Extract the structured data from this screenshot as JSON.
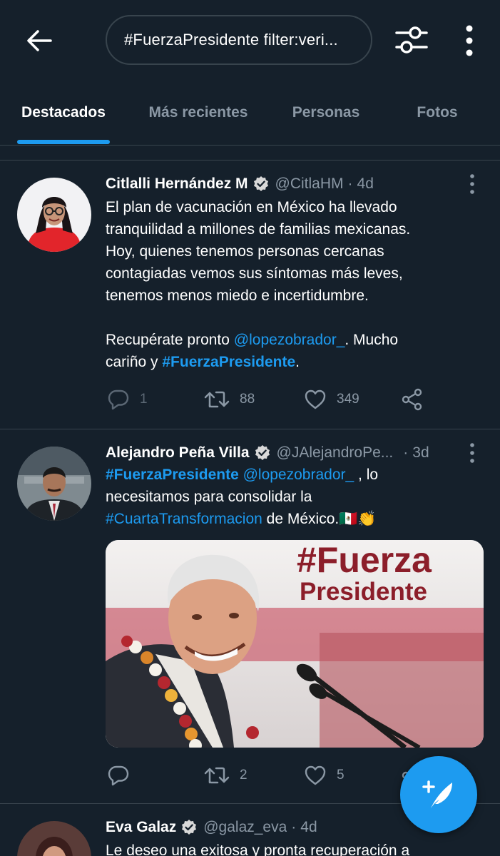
{
  "search": {
    "query": "#FuerzaPresidente  filter:veri..."
  },
  "tabs": [
    {
      "label": "Destacados",
      "active": true
    },
    {
      "label": "Más recientes",
      "active": false
    },
    {
      "label": "Personas",
      "active": false
    },
    {
      "label": "Fotos",
      "active": false
    }
  ],
  "tweets": [
    {
      "name": "Citlalli Hernández M",
      "handle": "@CitlaHM",
      "time": "4d",
      "text_lines": [
        "El plan de vacunación en México ha llevado",
        "tranquilidad a millones de familias mexicanas.",
        "Hoy, quienes tenemos personas cercanas",
        "contagiadas vemos sus síntomas más leves,",
        "tenemos menos miedo e incertidumbre."
      ],
      "p2_a": "Recupérate pronto ",
      "p2_mention": "@lopezobrador_",
      "p2_b": ". Mucho",
      "p3_a": "cariño y ",
      "p3_tag": "#FuerzaPresidente",
      "p3_b": ".",
      "replies": "1",
      "retweets": "88",
      "likes": "349"
    },
    {
      "name": "Alejandro Peña Villa",
      "handle": "@JAlejandroPe...",
      "time": "3d",
      "l1_tag": "#FuerzaPresidente",
      "l1_mention": "@lopezobrador_",
      "l1_rest": " , lo",
      "l2": "necesitamos para consolidar la",
      "l3_tag": "#CuartaTransformacion",
      "l3_rest": " de México.🇲🇽👏",
      "media_title_1": "#Fuerza",
      "media_title_2": "Presidente",
      "retweets": "2",
      "likes": "5"
    },
    {
      "name": "Eva Galaz",
      "handle": "@galaz_eva",
      "time": "4d",
      "text_line": "Le deseo una exitosa y pronta recuperación a"
    }
  ],
  "colors": {
    "background": "#15202b",
    "accent": "#1d9bf0",
    "muted": "#8b98a5",
    "divider": "#38444d"
  },
  "icons": [
    "back-arrow-icon",
    "filter-sliders-icon",
    "more-vertical-icon",
    "verified-badge-icon",
    "reply-icon",
    "retweet-icon",
    "like-heart-icon",
    "share-icon",
    "compose-tweet-icon"
  ]
}
